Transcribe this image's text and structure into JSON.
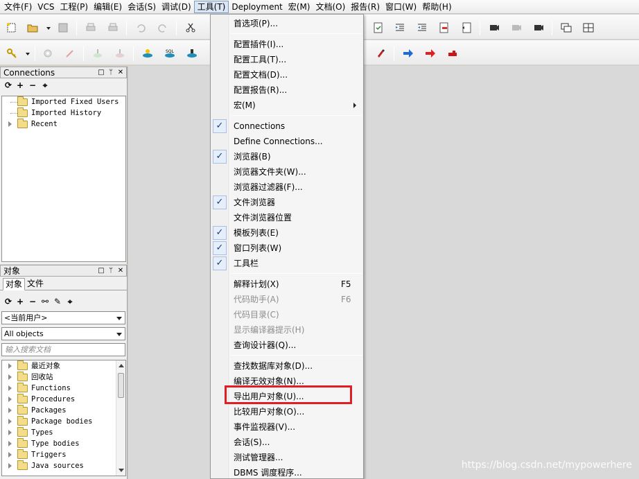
{
  "menubar": [
    {
      "label": "文件(F)"
    },
    {
      "label": "VCS"
    },
    {
      "label": "工程(P)"
    },
    {
      "label": "编辑(E)"
    },
    {
      "label": "会话(S)"
    },
    {
      "label": "调试(D)"
    },
    {
      "label": "工具(T)",
      "active": true
    },
    {
      "label": "Deployment"
    },
    {
      "label": "宏(M)"
    },
    {
      "label": "文档(O)"
    },
    {
      "label": "报告(R)"
    },
    {
      "label": "窗口(W)"
    },
    {
      "label": "帮助(H)"
    }
  ],
  "connections_pane": {
    "title": "Connections",
    "items": [
      "Imported Fixed Users",
      "Imported History",
      "Recent"
    ]
  },
  "objects_pane": {
    "title": "对象",
    "tabs": [
      "对象",
      "文件"
    ],
    "user_combo": "<当前用户>",
    "type_combo": "All objects",
    "search_placeholder": "输入搜索文档",
    "items": [
      "最近对象",
      "回收站",
      "Functions",
      "Procedures",
      "Packages",
      "Package bodies",
      "Types",
      "Type bodies",
      "Triggers",
      "Java sources"
    ]
  },
  "tools_menu": {
    "items": [
      {
        "label": "首选项(P)..."
      },
      {
        "sep": true
      },
      {
        "label": "配置插件(I)..."
      },
      {
        "label": "配置工具(T)..."
      },
      {
        "label": "配置文档(D)..."
      },
      {
        "label": "配置报告(R)..."
      },
      {
        "label": "宏(M)",
        "submenu": true
      },
      {
        "sep": true
      },
      {
        "label": "Connections",
        "checked": true
      },
      {
        "label": "Define Connections..."
      },
      {
        "label": "浏览器(B)",
        "checked": true
      },
      {
        "label": "浏览器文件夹(W)..."
      },
      {
        "label": "浏览器过滤器(F)..."
      },
      {
        "label": "文件浏览器",
        "checked": true
      },
      {
        "label": "文件浏览器位置"
      },
      {
        "label": "模板列表(E)",
        "checked": true
      },
      {
        "label": "窗口列表(W)",
        "checked": true
      },
      {
        "label": "工具栏",
        "checked": true
      },
      {
        "sep": true
      },
      {
        "label": "解释计划(X)",
        "shortcut": "F5"
      },
      {
        "label": "代码助手(A)",
        "shortcut": "F6",
        "disabled": true
      },
      {
        "label": "代码目录(C)",
        "disabled": true
      },
      {
        "label": "显示编译器提示(H)",
        "disabled": true
      },
      {
        "label": "查询设计器(Q)..."
      },
      {
        "sep": true
      },
      {
        "label": "查找数据库对象(D)..."
      },
      {
        "label": "编译无效对象(N)..."
      },
      {
        "label": "导出用户对象(U)...",
        "highlighted": true
      },
      {
        "label": "比较用户对象(O)..."
      },
      {
        "label": "事件监视器(V)..."
      },
      {
        "label": "会话(S)..."
      },
      {
        "label": "测试管理器..."
      },
      {
        "label": "DBMS 调度程序..."
      }
    ],
    "check_glyph": "✓"
  },
  "watermark": "https://blog.csdn.net/mypowerhere",
  "colors": {
    "highlight_box": "#e01e24",
    "workspace": "#d9d9d9"
  }
}
